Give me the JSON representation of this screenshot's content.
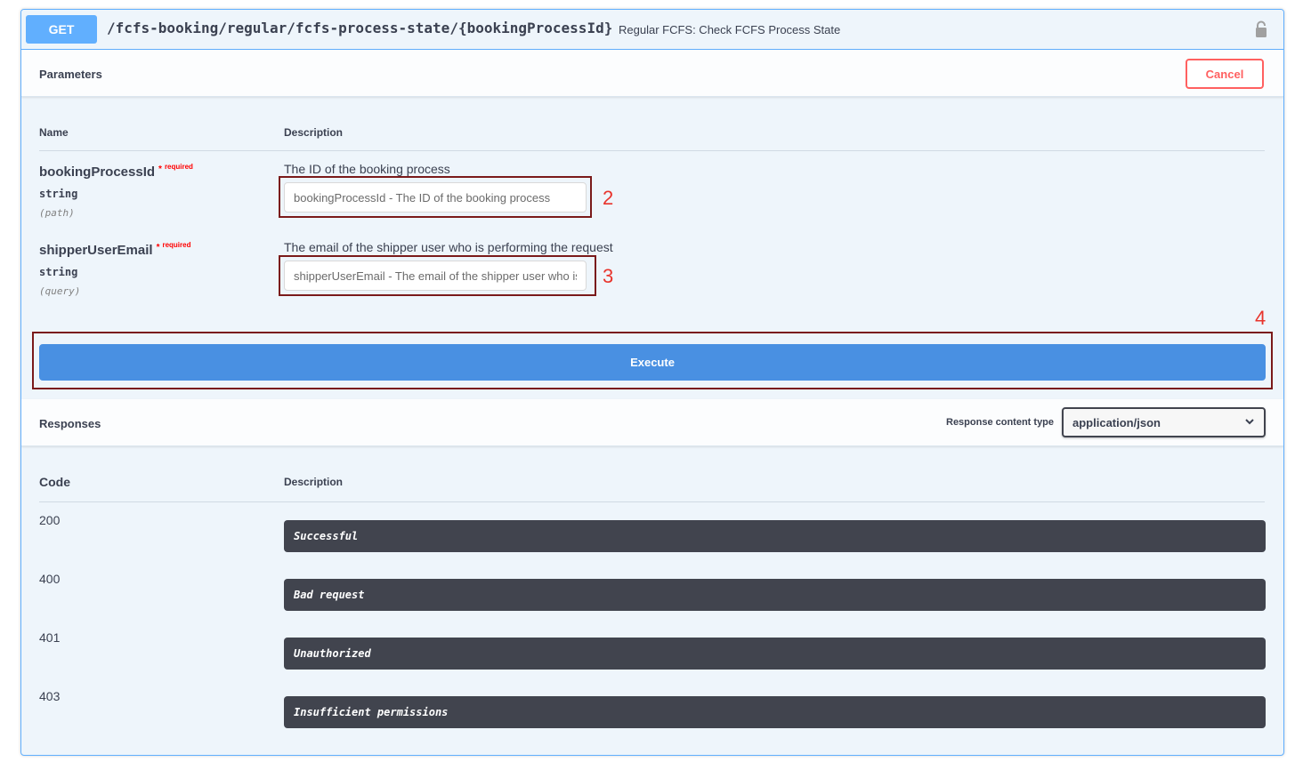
{
  "operation": {
    "method": "GET",
    "path": "/fcfs-booking/regular/fcfs-process-state/{bookingProcessId}",
    "summary": "Regular FCFS: Check FCFS Process State"
  },
  "parameters": {
    "title": "Parameters",
    "cancel_label": "Cancel",
    "col_name": "Name",
    "col_description": "Description",
    "items": [
      {
        "name": "bookingProcessId",
        "required_star": "*",
        "required_label": "required",
        "type": "string",
        "in": "(path)",
        "description": "The ID of the booking process",
        "placeholder": "bookingProcessId - The ID of the booking process",
        "annotation": "2"
      },
      {
        "name": "shipperUserEmail",
        "required_star": "*",
        "required_label": "required",
        "type": "string",
        "in": "(query)",
        "description": "The email of the shipper user who is performing the request",
        "placeholder": "shipperUserEmail - The email of the shipper user who is performing the request",
        "annotation": "3"
      }
    ]
  },
  "execute": {
    "label": "Execute",
    "annotation": "4"
  },
  "responses": {
    "title": "Responses",
    "content_type_label": "Response content type",
    "content_type_value": "application/json",
    "col_code": "Code",
    "col_description": "Description",
    "items": [
      {
        "code": "200",
        "description": "Successful"
      },
      {
        "code": "400",
        "description": "Bad request"
      },
      {
        "code": "401",
        "description": "Unauthorized"
      },
      {
        "code": "403",
        "description": "Insufficient permissions"
      }
    ]
  },
  "colors": {
    "get_accent": "#61affe",
    "execute_blue": "#4990e2",
    "cancel_red": "#ff6060",
    "annotation_red": "#e8342c",
    "response_bar": "#41444e"
  }
}
